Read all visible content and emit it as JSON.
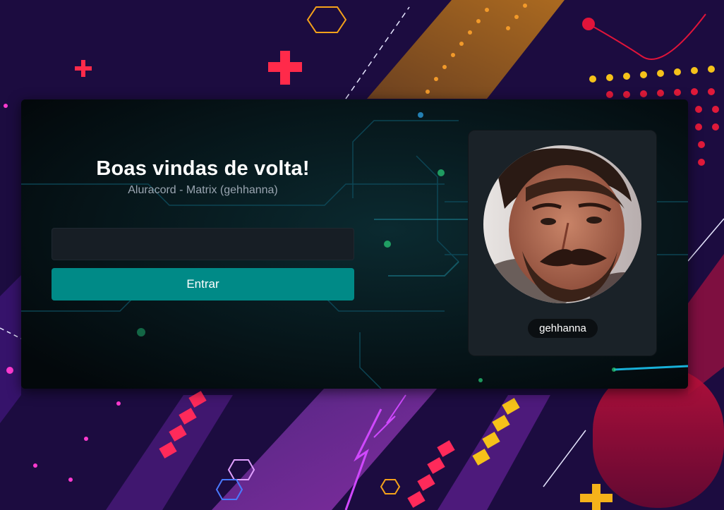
{
  "colors": {
    "background": "#2a0d5c",
    "card": "#04090c",
    "primary_button": "#008a87",
    "input_background": "#171e25",
    "panel_background": "#1a2228",
    "badge_background": "#0b0f12",
    "subtitle_text": "#9aa5b1"
  },
  "login": {
    "title": "Boas vindas de volta!",
    "subtitle": "Aluracord - Matrix (gehhanna)",
    "input": {
      "value": "",
      "placeholder": ""
    },
    "submit_label": "Entrar"
  },
  "profile": {
    "avatar_icon": "user-photo",
    "username": "gehhanna"
  }
}
